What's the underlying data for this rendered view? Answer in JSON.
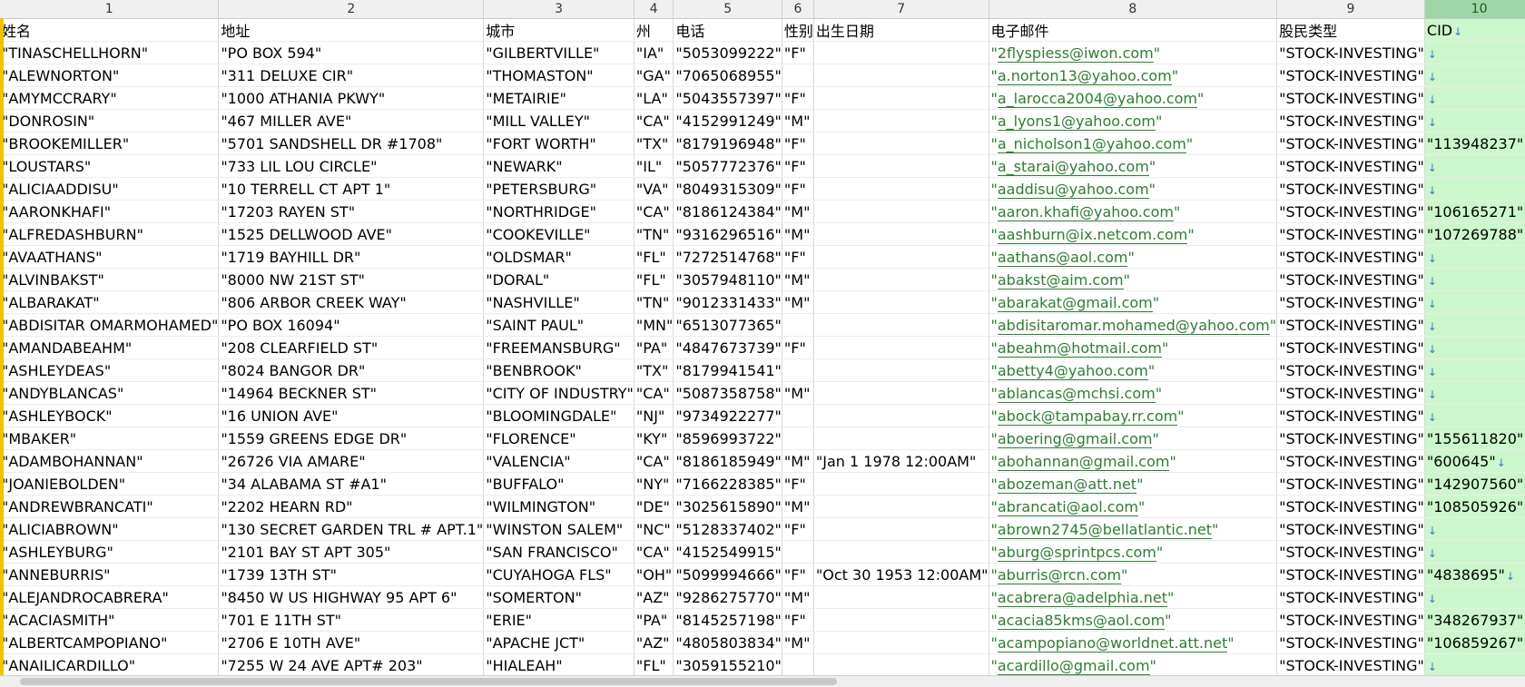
{
  "columns": [
    "1",
    "2",
    "3",
    "4",
    "5",
    "6",
    "7",
    "8",
    "9",
    "10"
  ],
  "headers": [
    "姓名",
    "地址",
    "城市",
    "州",
    "电话",
    "性别",
    "出生日期",
    "电子邮件",
    "股民类型",
    "CID"
  ],
  "rows": [
    [
      "\"TINASCHELLHORN\"",
      "\"PO BOX 594\"",
      "\"GILBERTVILLE\"",
      "\"IA\"",
      "\"5053099222\"",
      "\"F\"",
      "",
      "\"2flyspiess@iwon.com\"",
      "\"STOCK-INVESTING\"",
      ""
    ],
    [
      "\"ALEWNORTON\"",
      "\"311 DELUXE CIR\"",
      "\"THOMASTON\"",
      "\"GA\"",
      "\"7065068955\"",
      "",
      "",
      "\"a.norton13@yahoo.com\"",
      "\"STOCK-INVESTING\"",
      ""
    ],
    [
      "\"AMYMCCRARY\"",
      "\"1000 ATHANIA PKWY\"",
      "\"METAIRIE\"",
      "\"LA\"",
      "\"5043557397\"",
      "\"F\"",
      "",
      "\"a_larocca2004@yahoo.com\"",
      "\"STOCK-INVESTING\"",
      ""
    ],
    [
      "\"DONROSIN\"",
      "\"467 MILLER AVE\"",
      "\"MILL VALLEY\"",
      "\"CA\"",
      "\"4152991249\"",
      "\"M\"",
      "",
      "\"a_lyons1@yahoo.com\"",
      "\"STOCK-INVESTING\"",
      ""
    ],
    [
      "\"BROOKEMILLER\"",
      "\"5701 SANDSHELL DR #1708\"",
      "\"FORT WORTH\"",
      "\"TX\"",
      "\"8179196948\"",
      "\"F\"",
      "",
      "\"a_nicholson1@yahoo.com\"",
      "\"STOCK-INVESTING\"",
      "\"113948237\""
    ],
    [
      "\"LOUSTARS\"",
      "\"733 LIL LOU CIRCLE\"",
      "\"NEWARK\"",
      "\"IL\"",
      "\"5057772376\"",
      "\"F\"",
      "",
      "\"a_starai@yahoo.com\"",
      "\"STOCK-INVESTING\"",
      ""
    ],
    [
      "\"ALICIAADDISU\"",
      "\"10 TERRELL CT APT 1\"",
      "\"PETERSBURG\"",
      "\"VA\"",
      "\"8049315309\"",
      "\"F\"",
      "",
      "\"aaddisu@yahoo.com\"",
      "\"STOCK-INVESTING\"",
      ""
    ],
    [
      "\"AARONKHAFI\"",
      "\"17203 RAYEN ST\"",
      "\"NORTHRIDGE\"",
      "\"CA\"",
      "\"8186124384\"",
      "\"M\"",
      "",
      "\"aaron.khafi@yahoo.com\"",
      "\"STOCK-INVESTING\"",
      "\"106165271\""
    ],
    [
      "\"ALFREDASHBURN\"",
      "\"1525 DELLWOOD AVE\"",
      "\"COOKEVILLE\"",
      "\"TN\"",
      "\"9316296516\"",
      "\"M\"",
      "",
      "\"aashburn@ix.netcom.com\"",
      "\"STOCK-INVESTING\"",
      "\"107269788\""
    ],
    [
      "\"AVAATHANS\"",
      "\"1719 BAYHILL DR\"",
      "\"OLDSMAR\"",
      "\"FL\"",
      "\"7272514768\"",
      "\"F\"",
      "",
      "\"aathans@aol.com\"",
      "\"STOCK-INVESTING\"",
      ""
    ],
    [
      "\"ALVINBAKST\"",
      "\"8000 NW 21ST ST\"",
      "\"DORAL\"",
      "\"FL\"",
      "\"3057948110\"",
      "\"M\"",
      "",
      "\"abakst@aim.com\"",
      "\"STOCK-INVESTING\"",
      ""
    ],
    [
      "\"ALBARAKAT\"",
      "\"806 ARBOR CREEK WAY\"",
      "\"NASHVILLE\"",
      "\"TN\"",
      "\"9012331433\"",
      "\"M\"",
      "",
      "\"abarakat@gmail.com\"",
      "\"STOCK-INVESTING\"",
      ""
    ],
    [
      "\"ABDISITAR OMARMOHAMED\"",
      "\"PO BOX 16094\"",
      "\"SAINT PAUL\"",
      "\"MN\"",
      "\"6513077365\"",
      "",
      "",
      "\"abdisitaromar.mohamed@yahoo.com\"",
      "\"STOCK-INVESTING\"",
      ""
    ],
    [
      "\"AMANDABEAHM\"",
      "\"208 CLEARFIELD ST\"",
      "\"FREEMANSBURG\"",
      "\"PA\"",
      "\"4847673739\"",
      "\"F\"",
      "",
      "\"abeahm@hotmail.com\"",
      "\"STOCK-INVESTING\"",
      ""
    ],
    [
      "\"ASHLEYDEAS\"",
      "\"8024 BANGOR DR\"",
      "\"BENBROOK\"",
      "\"TX\"",
      "\"8179941541\"",
      "",
      "",
      "\"abetty4@yahoo.com\"",
      "\"STOCK-INVESTING\"",
      ""
    ],
    [
      "\"ANDYBLANCAS\"",
      "\"14964 BECKNER ST\"",
      "\"CITY OF INDUSTRY\"",
      "\"CA\"",
      "\"5087358758\"",
      "\"M\"",
      "",
      "\"ablancas@mchsi.com\"",
      "\"STOCK-INVESTING\"",
      ""
    ],
    [
      "\"ASHLEYBOCK\"",
      "\"16 UNION AVE\"",
      "\"BLOOMINGDALE\"",
      "\"NJ\"",
      "\"9734922277\"",
      "",
      "",
      "\"abock@tampabay.rr.com\"",
      "\"STOCK-INVESTING\"",
      ""
    ],
    [
      "\"MBAKER\"",
      "\"1559 GREENS EDGE DR\"",
      "\"FLORENCE\"",
      "\"KY\"",
      "\"8596993722\"",
      "",
      "",
      "\"aboering@gmail.com\"",
      "\"STOCK-INVESTING\"",
      "\"155611820\""
    ],
    [
      "\"ADAMBOHANNAN\"",
      "\"26726 VIA AMARE\"",
      "\"VALENCIA\"",
      "\"CA\"",
      "\"8186185949\"",
      "\"M\"",
      "\"Jan  1 1978 12:00AM\"",
      "\"abohannan@gmail.com\"",
      "\"STOCK-INVESTING\"",
      "\"600645\""
    ],
    [
      "\"JOANIEBOLDEN\"",
      "\"34 ALABAMA ST #A1\"",
      "\"BUFFALO\"",
      "\"NY\"",
      "\"7166228385\"",
      "\"F\"",
      "",
      "\"abozeman@att.net\"",
      "\"STOCK-INVESTING\"",
      "\"142907560\""
    ],
    [
      "\"ANDREWBRANCATI\"",
      "\"2202 HEARN RD\"",
      "\"WILMINGTON\"",
      "\"DE\"",
      "\"3025615890\"",
      "\"M\"",
      "",
      "\"abrancati@aol.com\"",
      "\"STOCK-INVESTING\"",
      "\"108505926\""
    ],
    [
      "\"ALICIABROWN\"",
      "\"130 SECRET GARDEN TRL # APT.1\"",
      "\"WINSTON SALEM\"",
      "\"NC\"",
      "\"5128337402\"",
      "\"F\"",
      "",
      "\"abrown2745@bellatlantic.net\"",
      "\"STOCK-INVESTING\"",
      ""
    ],
    [
      "\"ASHLEYBURG\"",
      "\"2101 BAY ST APT 305\"",
      "\"SAN FRANCISCO\"",
      "\"CA\"",
      "\"4152549915\"",
      "",
      "",
      "\"aburg@sprintpcs.com\"",
      "\"STOCK-INVESTING\"",
      ""
    ],
    [
      "\"ANNEBURRIS\"",
      "\"1739 13TH ST\"",
      "\"CUYAHOGA FLS\"",
      "\"OH\"",
      "\"5099994666\"",
      "\"F\"",
      "\"Oct 30 1953 12:00AM\"",
      "\"aburris@rcn.com\"",
      "\"STOCK-INVESTING\"",
      "\"4838695\""
    ],
    [
      "\"ALEJANDROCABRERA\"",
      "\"8450 W US HIGHWAY 95 APT 6\"",
      "\"SOMERTON\"",
      "\"AZ\"",
      "\"9286275770\"",
      "\"M\"",
      "",
      "\"acabrera@adelphia.net\"",
      "\"STOCK-INVESTING\"",
      ""
    ],
    [
      "\"ACACIASMITH\"",
      "\"701 E 11TH ST\"",
      "\"ERIE\"",
      "\"PA\"",
      "\"8145257198\"",
      "\"F\"",
      "",
      "\"acacia85kms@aol.com\"",
      "\"STOCK-INVESTING\"",
      "\"348267937\""
    ],
    [
      "\"ALBERTCAMPOPIANO\"",
      "\"2706 E 10TH AVE\"",
      "\"APACHE JCT\"",
      "\"AZ\"",
      "\"4805803834\"",
      "\"M\"",
      "",
      "\"acampopiano@worldnet.att.net\"",
      "\"STOCK-INVESTING\"",
      "\"106859267\""
    ],
    [
      "\"ANAILICARDILLO\"",
      "\"7255 W 24 AVE APT# 203\"",
      "\"HIALEAH\"",
      "\"FL\"",
      "\"3059155210\"",
      "",
      "",
      "\"acardillo@gmail.com\"",
      "\"STOCK-INVESTING\"",
      ""
    ]
  ],
  "arrow_glyph": "↓",
  "colors": {
    "selected_column": "#ccf7cc",
    "email_text": "#2e7d32",
    "header_bg": "#f0f0f0",
    "row_edge": "#f2c200"
  }
}
